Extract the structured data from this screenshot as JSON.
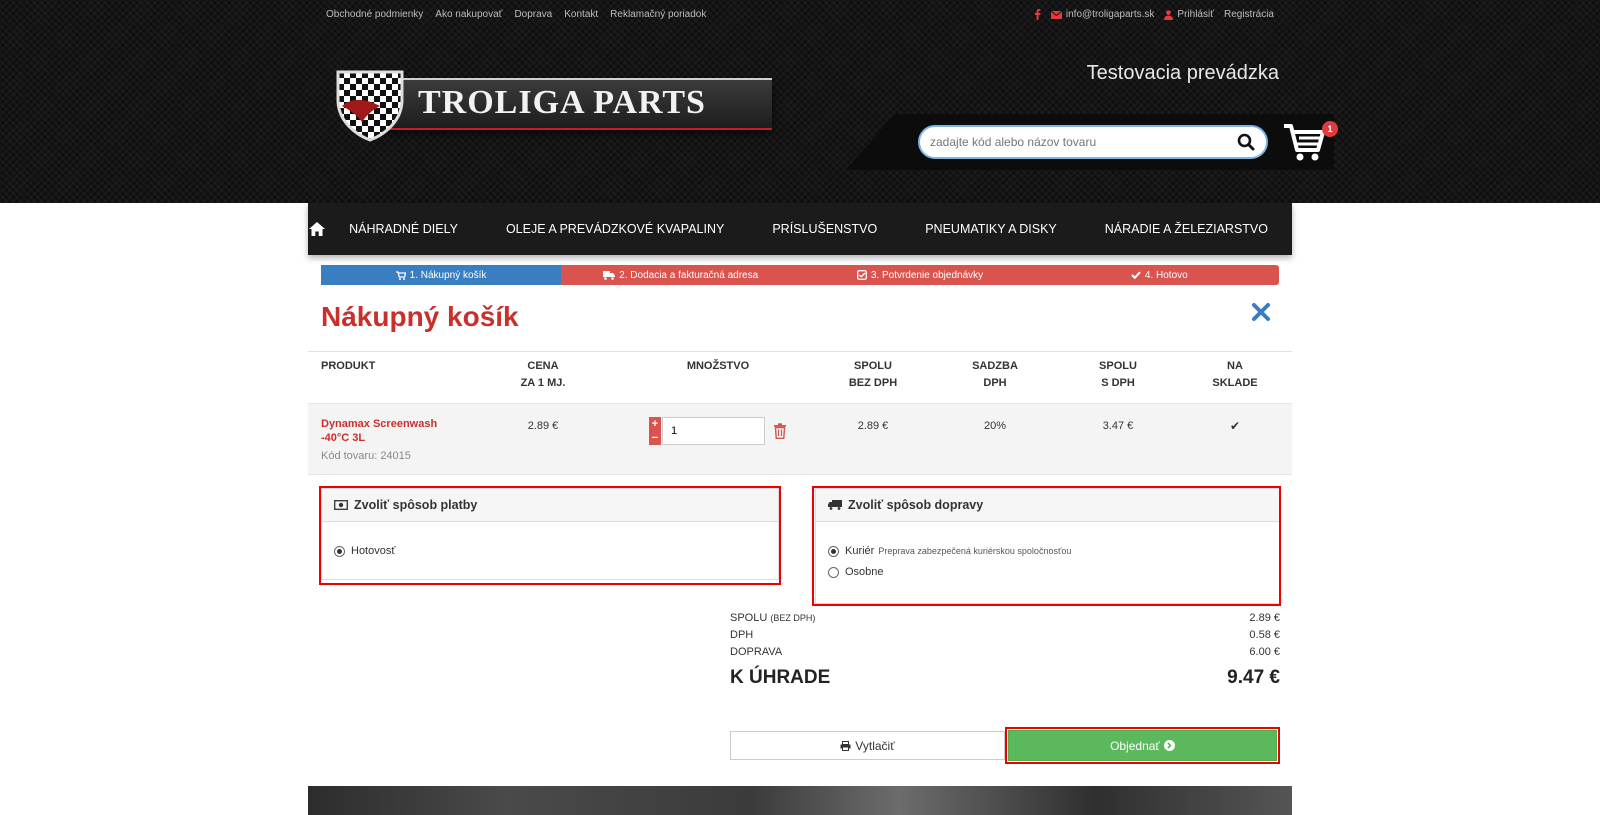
{
  "top_links": [
    "Obchodné podmienky",
    "Ako nakupovať",
    "Doprava",
    "Kontakt",
    "Reklamačný poriadok"
  ],
  "top_right": {
    "facebook_icon": "facebook-icon",
    "email": "info@troligaparts.sk",
    "login": "Prihlásiť",
    "register": "Registrácia"
  },
  "logo_text": "TROLIGA PARTS",
  "tagline": "Testovacia prevádzka",
  "search": {
    "placeholder": "zadajte kód alebo názov tovaru"
  },
  "cart_count": "1",
  "nav": {
    "items": [
      "NÁHRADNÉ DIELY",
      "OLEJE A PREVÁDZKOVÉ KVAPALINY",
      "PRÍSLUŠENSTVO",
      "PNEUMATIKY A DISKY",
      "NÁRADIE A ŽELEZIARSTVO"
    ]
  },
  "steps": [
    "1. Nákupný košík",
    "2. Dodacia a fakturačná adresa",
    "3. Potvrdenie objednávky",
    "4. Hotovo"
  ],
  "page_title": "Nákupný košík",
  "table": {
    "headers": {
      "product": "PRODUKT",
      "price_1": "CENA",
      "price_2": "ZA 1 MJ.",
      "qty": "MNOŽSTVO",
      "total_1": "SPOLU",
      "total_2": "BEZ DPH",
      "vat_1": "SADZBA",
      "vat_2": "DPH",
      "totalvat_1": "SPOLU",
      "totalvat_2": "S DPH",
      "stock_1": "NA",
      "stock_2": "SKLADE"
    },
    "row": {
      "name": "Dynamax Screenwash -40°C 3L",
      "code": "Kód tovaru: 24015",
      "price": "2.89 €",
      "qty": "1",
      "total": "2.89 €",
      "vat": "20%",
      "total_vat": "3.47 €",
      "in_stock": "✔"
    }
  },
  "payment": {
    "title": "Zvoliť spôsob platby",
    "options": [
      {
        "label": "Hotovosť",
        "selected": true
      }
    ]
  },
  "shipping": {
    "title": "Zvoliť spôsob dopravy",
    "options": [
      {
        "label": "Kuriér",
        "note": "Preprava zabezpečená kuriérskou spoločnosťou",
        "selected": true
      },
      {
        "label": "Osobne",
        "note": "",
        "selected": false
      }
    ]
  },
  "totals": {
    "subtotal_label": "SPOLU",
    "subtotal_note": "(BEZ DPH)",
    "subtotal": "2.89 €",
    "vat_label": "DPH",
    "vat": "0.58 €",
    "shipping_label": "DOPRAVA",
    "shipping": "6.00 €",
    "grand_label": "K ÚHRADE",
    "grand": "9.47 €"
  },
  "buttons": {
    "print": "Vytlačiť",
    "order": "Objednať"
  },
  "colors": {
    "accent_red": "#c9302c",
    "step_blue": "#3a7ec2",
    "step_red": "#d9534f",
    "order_green": "#5cb85c",
    "highlight_red": "#ee0000"
  }
}
